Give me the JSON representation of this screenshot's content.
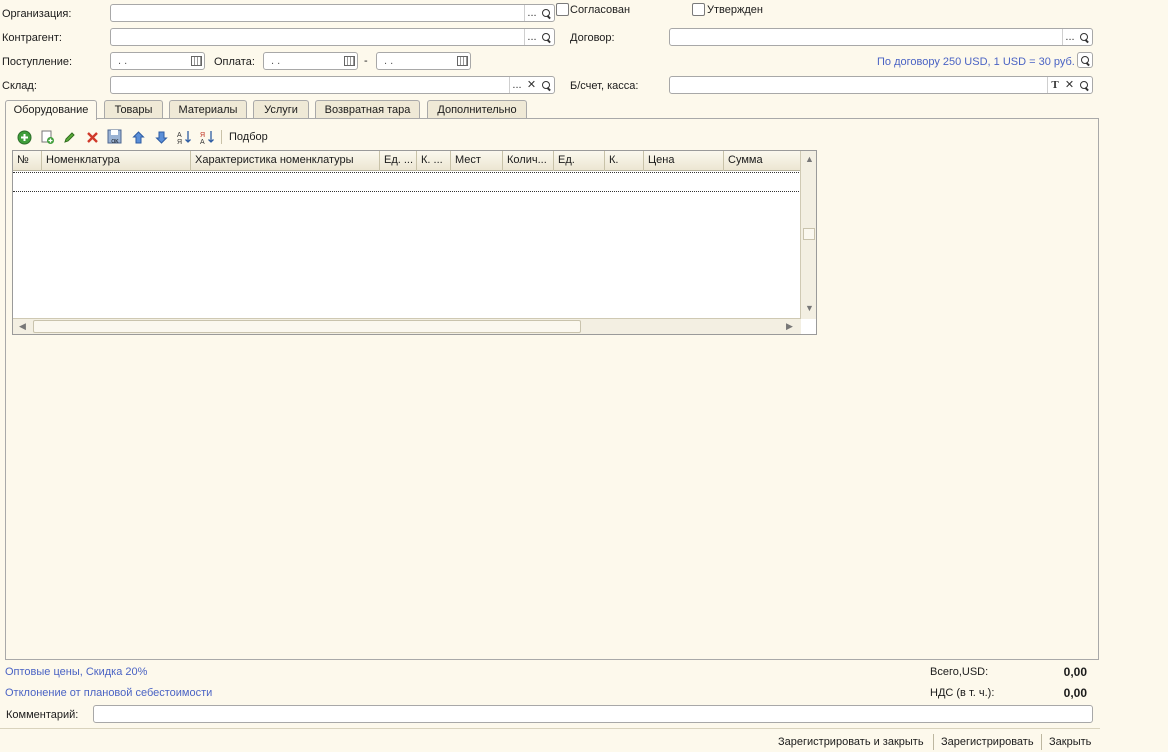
{
  "header": {
    "organization_label": "Организация:",
    "counterparty_label": "Контрагент:",
    "contract_label": "Договор:",
    "receipt_label": "Поступление:",
    "receipt_value": ". .",
    "payment_label": "Оплата:",
    "payment_from": ". .",
    "payment_dash": "-",
    "payment_to": ". .",
    "warehouse_label": "Склад:",
    "account_label": "Б/счет, касса:",
    "agreed_label": "Согласован",
    "approved_label": "Утвержден",
    "contract_info": "По договору 250 USD, 1 USD = 30 руб.",
    "dots": "..."
  },
  "tabs": [
    "Оборудование",
    "Товары",
    "Материалы",
    "Услуги",
    "Возвратная тара",
    "Дополнительно"
  ],
  "toolbar": {
    "selection_label": "Подбор"
  },
  "table": {
    "columns": [
      "№",
      "Номенклатура",
      "Характеристика номенклатуры",
      "Ед. ...",
      "К. ...",
      "Мест",
      "Колич...",
      "Ед.",
      "К.",
      "Цена",
      "Сумма"
    ]
  },
  "footer": {
    "prices_link": "Оптовые цены, Скидка 20%",
    "deviation_link": "Отклонение от плановой себестоимости",
    "total_label": "Всего,USD:",
    "total_value": "0,00",
    "vat_label": "НДС (в т. ч.):",
    "vat_value": "0,00",
    "comment_label": "Комментарий:"
  },
  "commands": {
    "register_close": "Зарегистрировать и закрыть",
    "register": "Зарегистрировать",
    "close": "Закрыть"
  },
  "colors": {
    "background": "#fdf9ec",
    "link": "#4a63c4",
    "delete": "#d03a2a",
    "add": "#3f9e3a"
  }
}
